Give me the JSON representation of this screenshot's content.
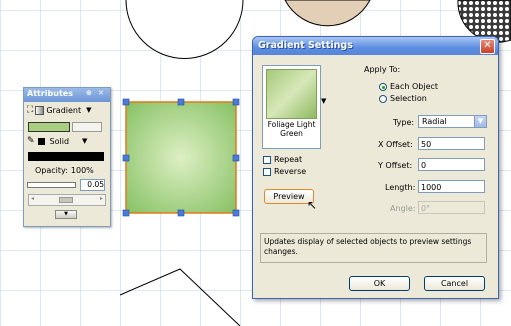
{
  "attributes_palette": {
    "title": "Attributes",
    "fill_type": "Gradient",
    "stroke_type": "Solid",
    "opacity_label": "Opacity:",
    "opacity_value": "100%",
    "stroke_width": "0.05",
    "fill_color": "#a7cf7f",
    "stroke_color": "#000000"
  },
  "dialog": {
    "title": "Gradient Settings",
    "apply_to_label": "Apply To:",
    "apply_to_options": [
      "Each Object",
      "Selection"
    ],
    "apply_to_selected": "Each Object",
    "gradient_name": "Foliage Light Green",
    "repeat_label": "Repeat",
    "reverse_label": "Reverse",
    "preview_button": "Preview",
    "type_label": "Type:",
    "type_value": "Radial",
    "x_offset_label": "X Offset:",
    "x_offset_value": "50",
    "y_offset_label": "Y Offset:",
    "y_offset_value": "0",
    "length_label": "Length:",
    "length_value": "1000",
    "angle_label": "Angle:",
    "angle_value": "0°",
    "description": "Updates display of selected objects to preview settings changes.",
    "ok_button": "OK",
    "cancel_button": "Cancel"
  },
  "colors": {
    "title_bar": "#5d8ee2",
    "dialog_bg": "#ece9d8",
    "selection_handle": "#4a7bd6",
    "shape_gradient_center": "#d7ecb8",
    "shape_gradient_edge": "#8cc46a",
    "shape_outline": "#e07b1a"
  }
}
